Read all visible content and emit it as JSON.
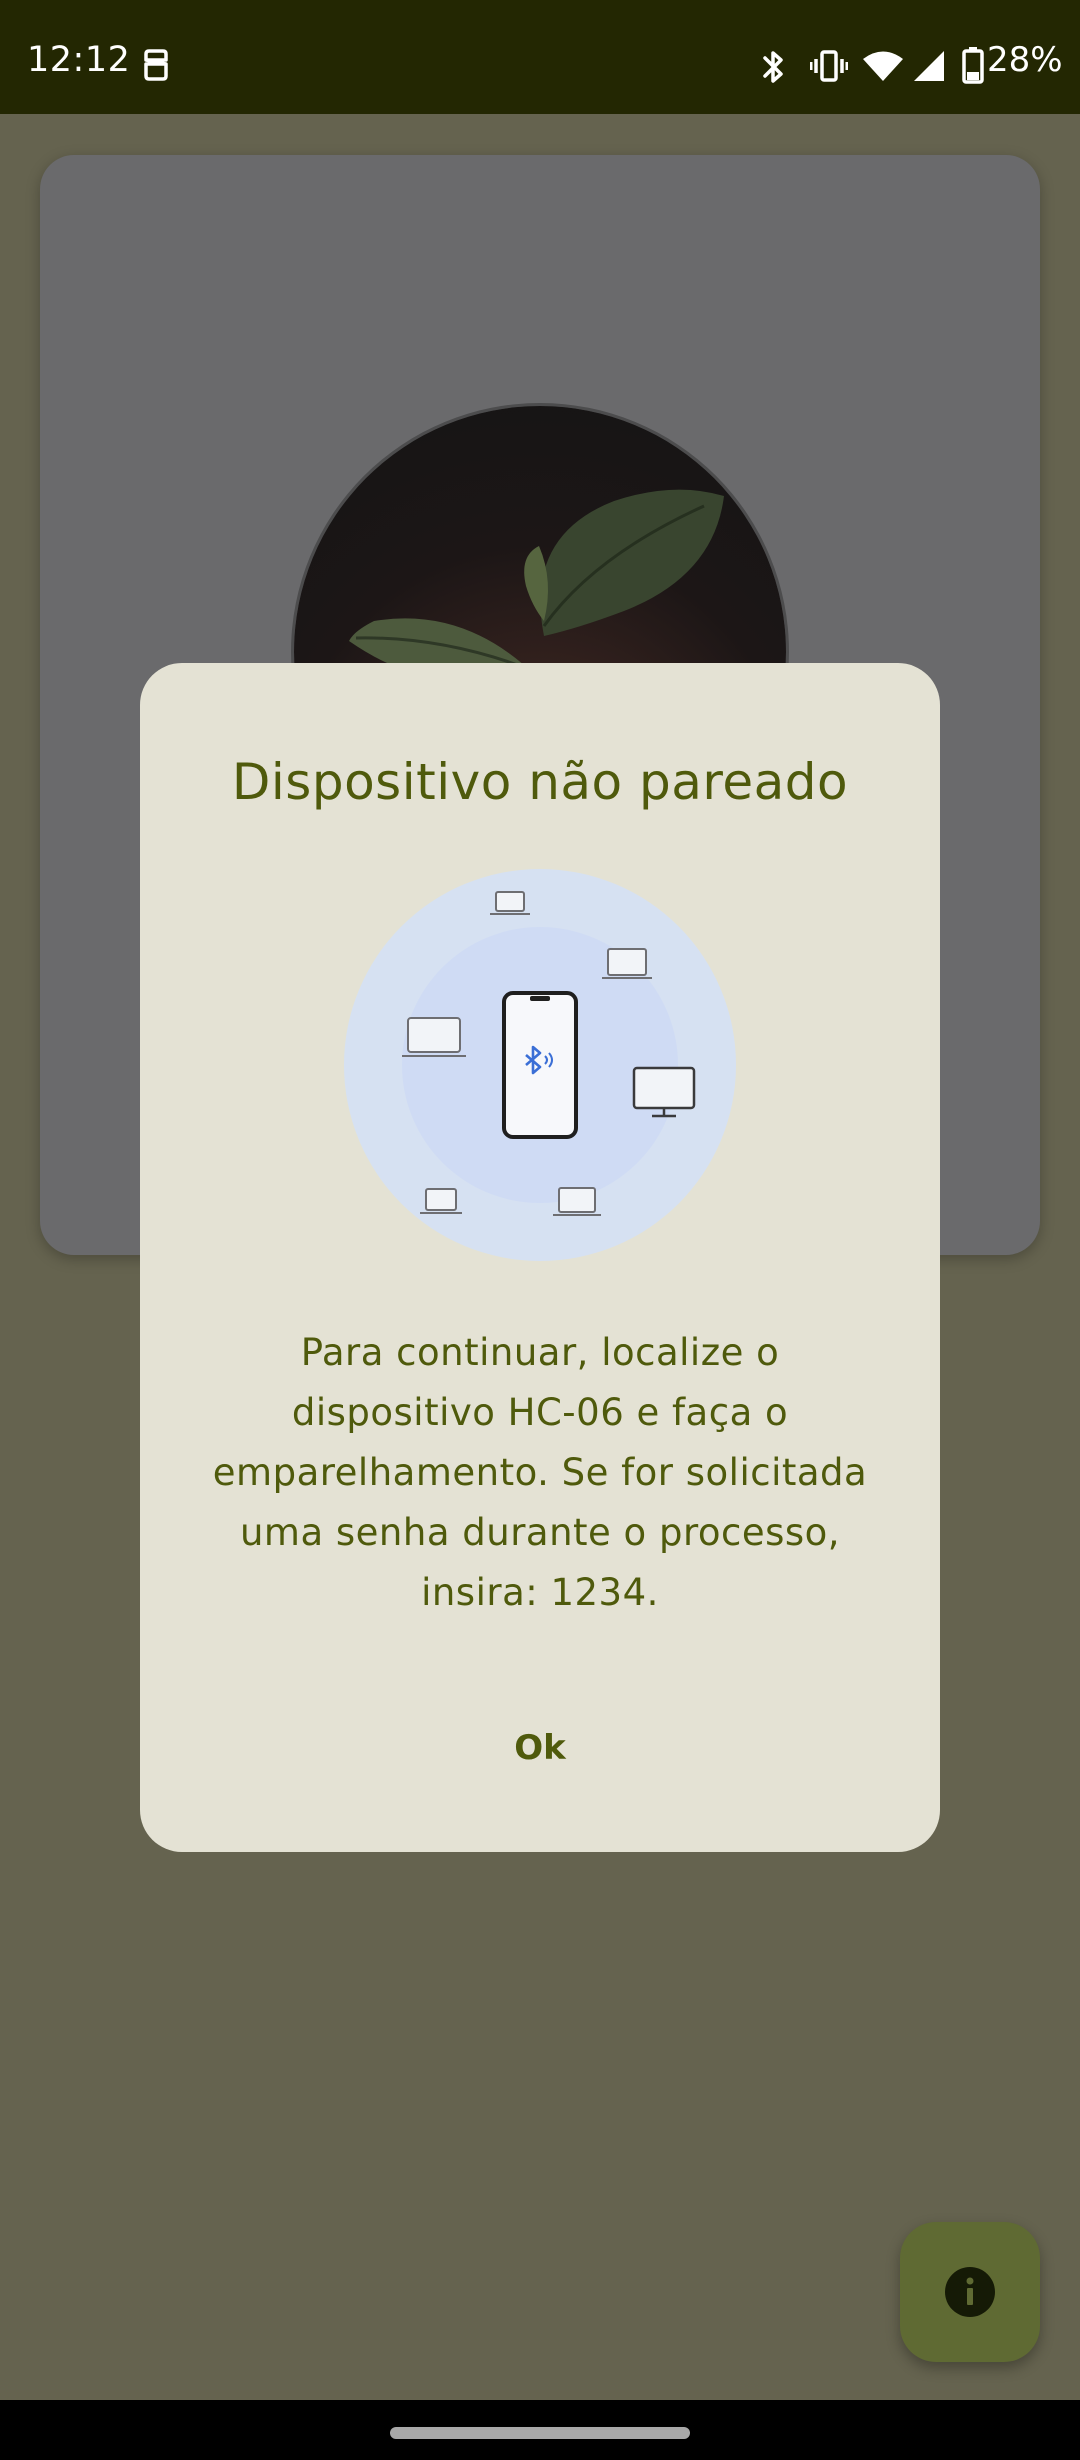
{
  "status_bar": {
    "time": "12:12",
    "battery_percent": "28%",
    "icons": [
      "sim-card-icon",
      "bluetooth-icon",
      "vibrate-icon",
      "wifi-icon",
      "signal-icon",
      "battery-icon"
    ]
  },
  "dialog": {
    "title": "Dispositivo não pareado",
    "message": "Para continuar, localize o dispositivo HC-06 e faça o emparelhamento. Se for solicitada uma senha durante o processo, insira: 1234.",
    "ok_label": "Ok"
  },
  "fab": {
    "icon": "info-icon"
  },
  "colors": {
    "status_bar_bg": "#232702",
    "scrim_bg": "#65634f",
    "dialog_bg": "#e4e2d4",
    "accent_text": "#4f5a0c",
    "fab_bg": "#5f6a33",
    "illustration_outer": "#d6e1f2",
    "illustration_inner": "#cfdbf4",
    "bluetooth_blue": "#3b6fd6"
  }
}
